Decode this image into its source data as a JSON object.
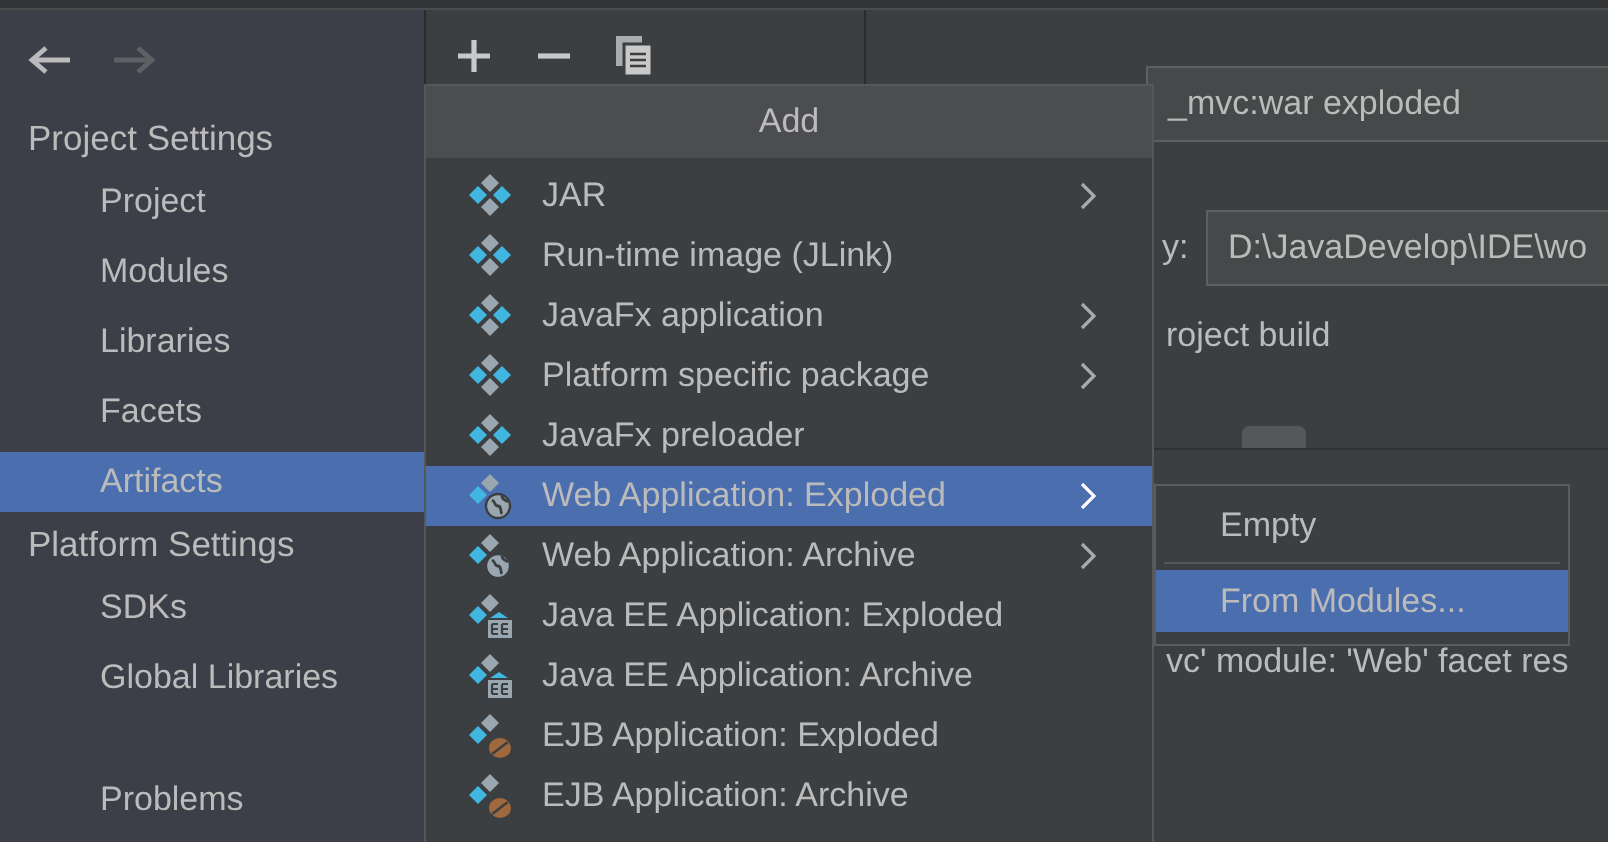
{
  "sidebar": {
    "sections": [
      {
        "title": "Project Settings",
        "items": [
          {
            "label": "Project",
            "selected": false
          },
          {
            "label": "Modules",
            "selected": false
          },
          {
            "label": "Libraries",
            "selected": false
          },
          {
            "label": "Facets",
            "selected": false
          },
          {
            "label": "Artifacts",
            "selected": true
          }
        ]
      },
      {
        "title": "Platform Settings",
        "items": [
          {
            "label": "SDKs",
            "selected": false
          },
          {
            "label": "Global Libraries",
            "selected": false
          }
        ]
      },
      {
        "items": [
          {
            "label": "Problems",
            "selected": false
          }
        ]
      }
    ]
  },
  "artifact": {
    "name": "_mvc:war exploded",
    "output_label": "y:",
    "output_path": "D:\\JavaDevelop\\IDE\\wo",
    "build_option": "roject build",
    "message": "vc' module: 'Web' facet res"
  },
  "add_menu": {
    "title": "Add",
    "items": [
      {
        "label": "JAR",
        "kind": "plain",
        "submenu": true,
        "selected": false
      },
      {
        "label": "Run-time image (JLink)",
        "kind": "plain",
        "submenu": false,
        "selected": false
      },
      {
        "label": "JavaFx application",
        "kind": "plain",
        "submenu": true,
        "selected": false
      },
      {
        "label": "Platform specific package",
        "kind": "plain",
        "submenu": true,
        "selected": false
      },
      {
        "label": "JavaFx preloader",
        "kind": "plain",
        "submenu": false,
        "selected": false
      },
      {
        "label": "Web Application: Exploded",
        "kind": "web",
        "submenu": true,
        "selected": true
      },
      {
        "label": "Web Application: Archive",
        "kind": "web",
        "submenu": true,
        "selected": false
      },
      {
        "label": "Java EE Application: Exploded",
        "kind": "ee",
        "submenu": false,
        "selected": false
      },
      {
        "label": "Java EE Application: Archive",
        "kind": "ee",
        "submenu": false,
        "selected": false
      },
      {
        "label": "EJB Application: Exploded",
        "kind": "ejb",
        "submenu": false,
        "selected": false
      },
      {
        "label": "EJB Application: Archive",
        "kind": "ejb",
        "submenu": false,
        "selected": false
      }
    ]
  },
  "submenu": {
    "items": [
      {
        "label": "Empty",
        "selected": false
      },
      {
        "label": "From Modules...",
        "selected": true
      }
    ]
  }
}
